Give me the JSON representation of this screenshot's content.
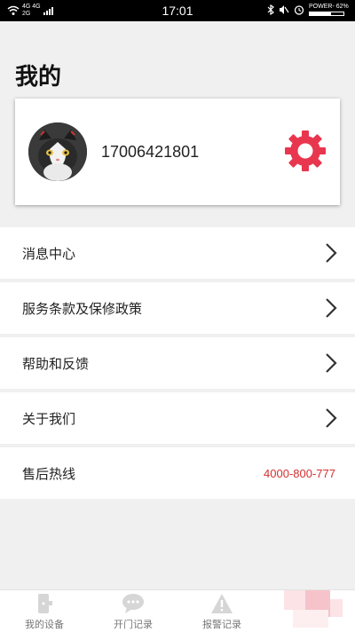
{
  "status_bar": {
    "network_top": "4G 4G",
    "network_bottom": "2G",
    "time": "17:01",
    "battery_label": "POWER- 62%",
    "battery_level": 0.62
  },
  "page": {
    "title": "我的"
  },
  "profile": {
    "phone": "17006421801"
  },
  "menu": [
    {
      "label": "消息中心",
      "chevron": true
    },
    {
      "label": "服务条款及保修政策",
      "chevron": true
    },
    {
      "label": "帮助和反馈",
      "chevron": true
    },
    {
      "label": "关于我们",
      "chevron": true
    },
    {
      "label": "售后热线",
      "value": "4000-800-777"
    }
  ],
  "tabbar": {
    "tabs": [
      {
        "label": "我的设备",
        "icon": "device-icon"
      },
      {
        "label": "开门记录",
        "icon": "chat-icon"
      },
      {
        "label": "报警记录",
        "icon": "alarm-icon"
      },
      {
        "label": "",
        "icon": "profile-icon"
      }
    ]
  },
  "colors": {
    "accent": "#e8364f",
    "hotline": "#d32f2f"
  }
}
